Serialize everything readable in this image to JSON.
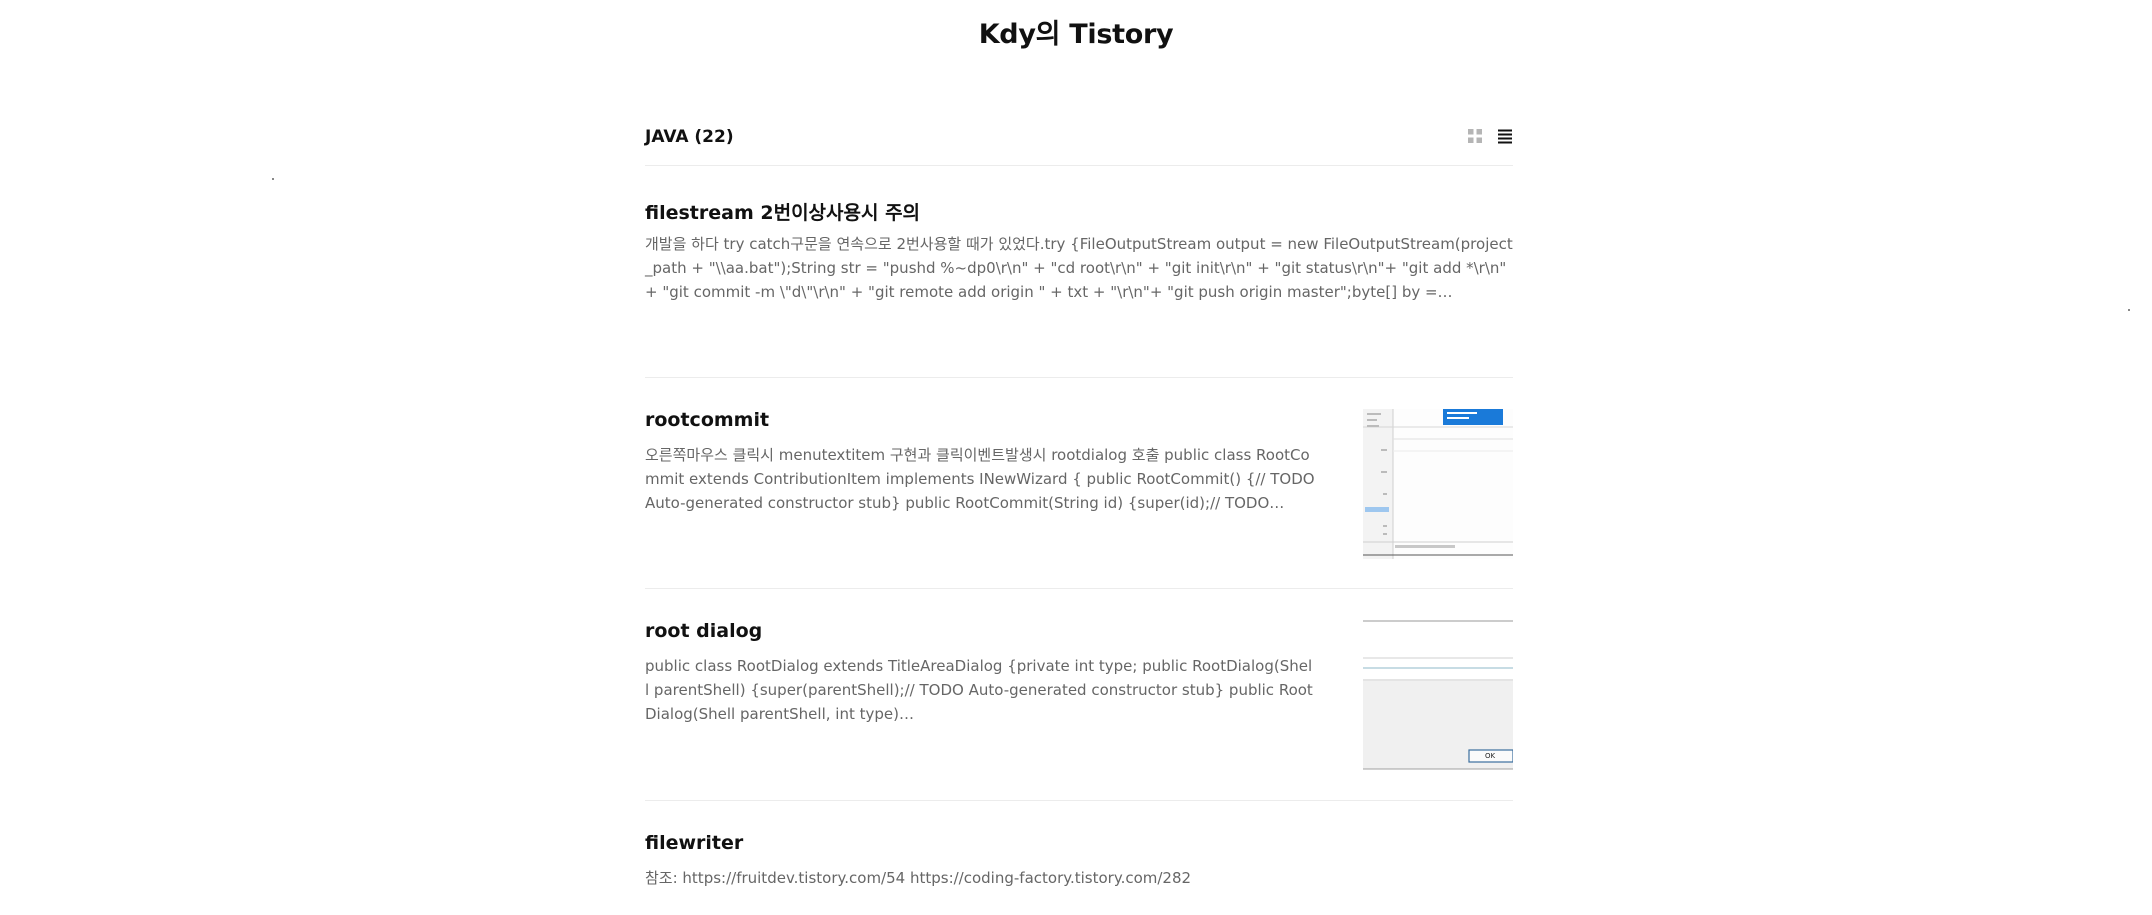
{
  "blog": {
    "title": "Kdy의 Tistory"
  },
  "category": {
    "label": "JAVA (22)"
  },
  "view_toggle": {
    "grid_icon": "grid-icon",
    "list_icon": "list-icon"
  },
  "posts": [
    {
      "title": "filestream 2번이상사용시 주의",
      "excerpt": "개발을 하다 try catch구문을 연속으로 2번사용할 때가 있었다.try {FileOutputStream output = new FileOutputStream(project_path + \"\\\\aa.bat\");String str = \"pushd %~dp0\\r\\n\" + \"cd root\\r\\n\" + \"git init\\r\\n\" + \"git status\\r\\n\"+ \"git add *\\r\\n\" + \"git commit -m \\\"d\\\"\\r\\n\" + \"git remote add origin \" + txt + \"\\r\\n\"+ \"git push origin master\";byte[] by =…"
    },
    {
      "title": "rootcommit",
      "excerpt": "오른쪽마우스 클릭시 menutextitem 구현과 클릭이벤트발생시 rootdialog 호출 public class RootCommit extends ContributionItem implements INewWizard { public RootCommit() {// TODO Auto-generated constructor stub} public RootCommit(String id) {super(id);// TODO…"
    },
    {
      "title": "root dialog",
      "excerpt": "public class RootDialog extends TitleAreaDialog {private int type; public RootDialog(Shell parentShell) {super(parentShell);// TODO Auto-generated constructor stub} public RootDialog(Shell parentShell, int type)…",
      "thumb_button": "OK"
    },
    {
      "title": "filewriter",
      "excerpt": "참조: https://fruitdev.tistory.com/54 https://coding-factory.tistory.com/282"
    }
  ]
}
